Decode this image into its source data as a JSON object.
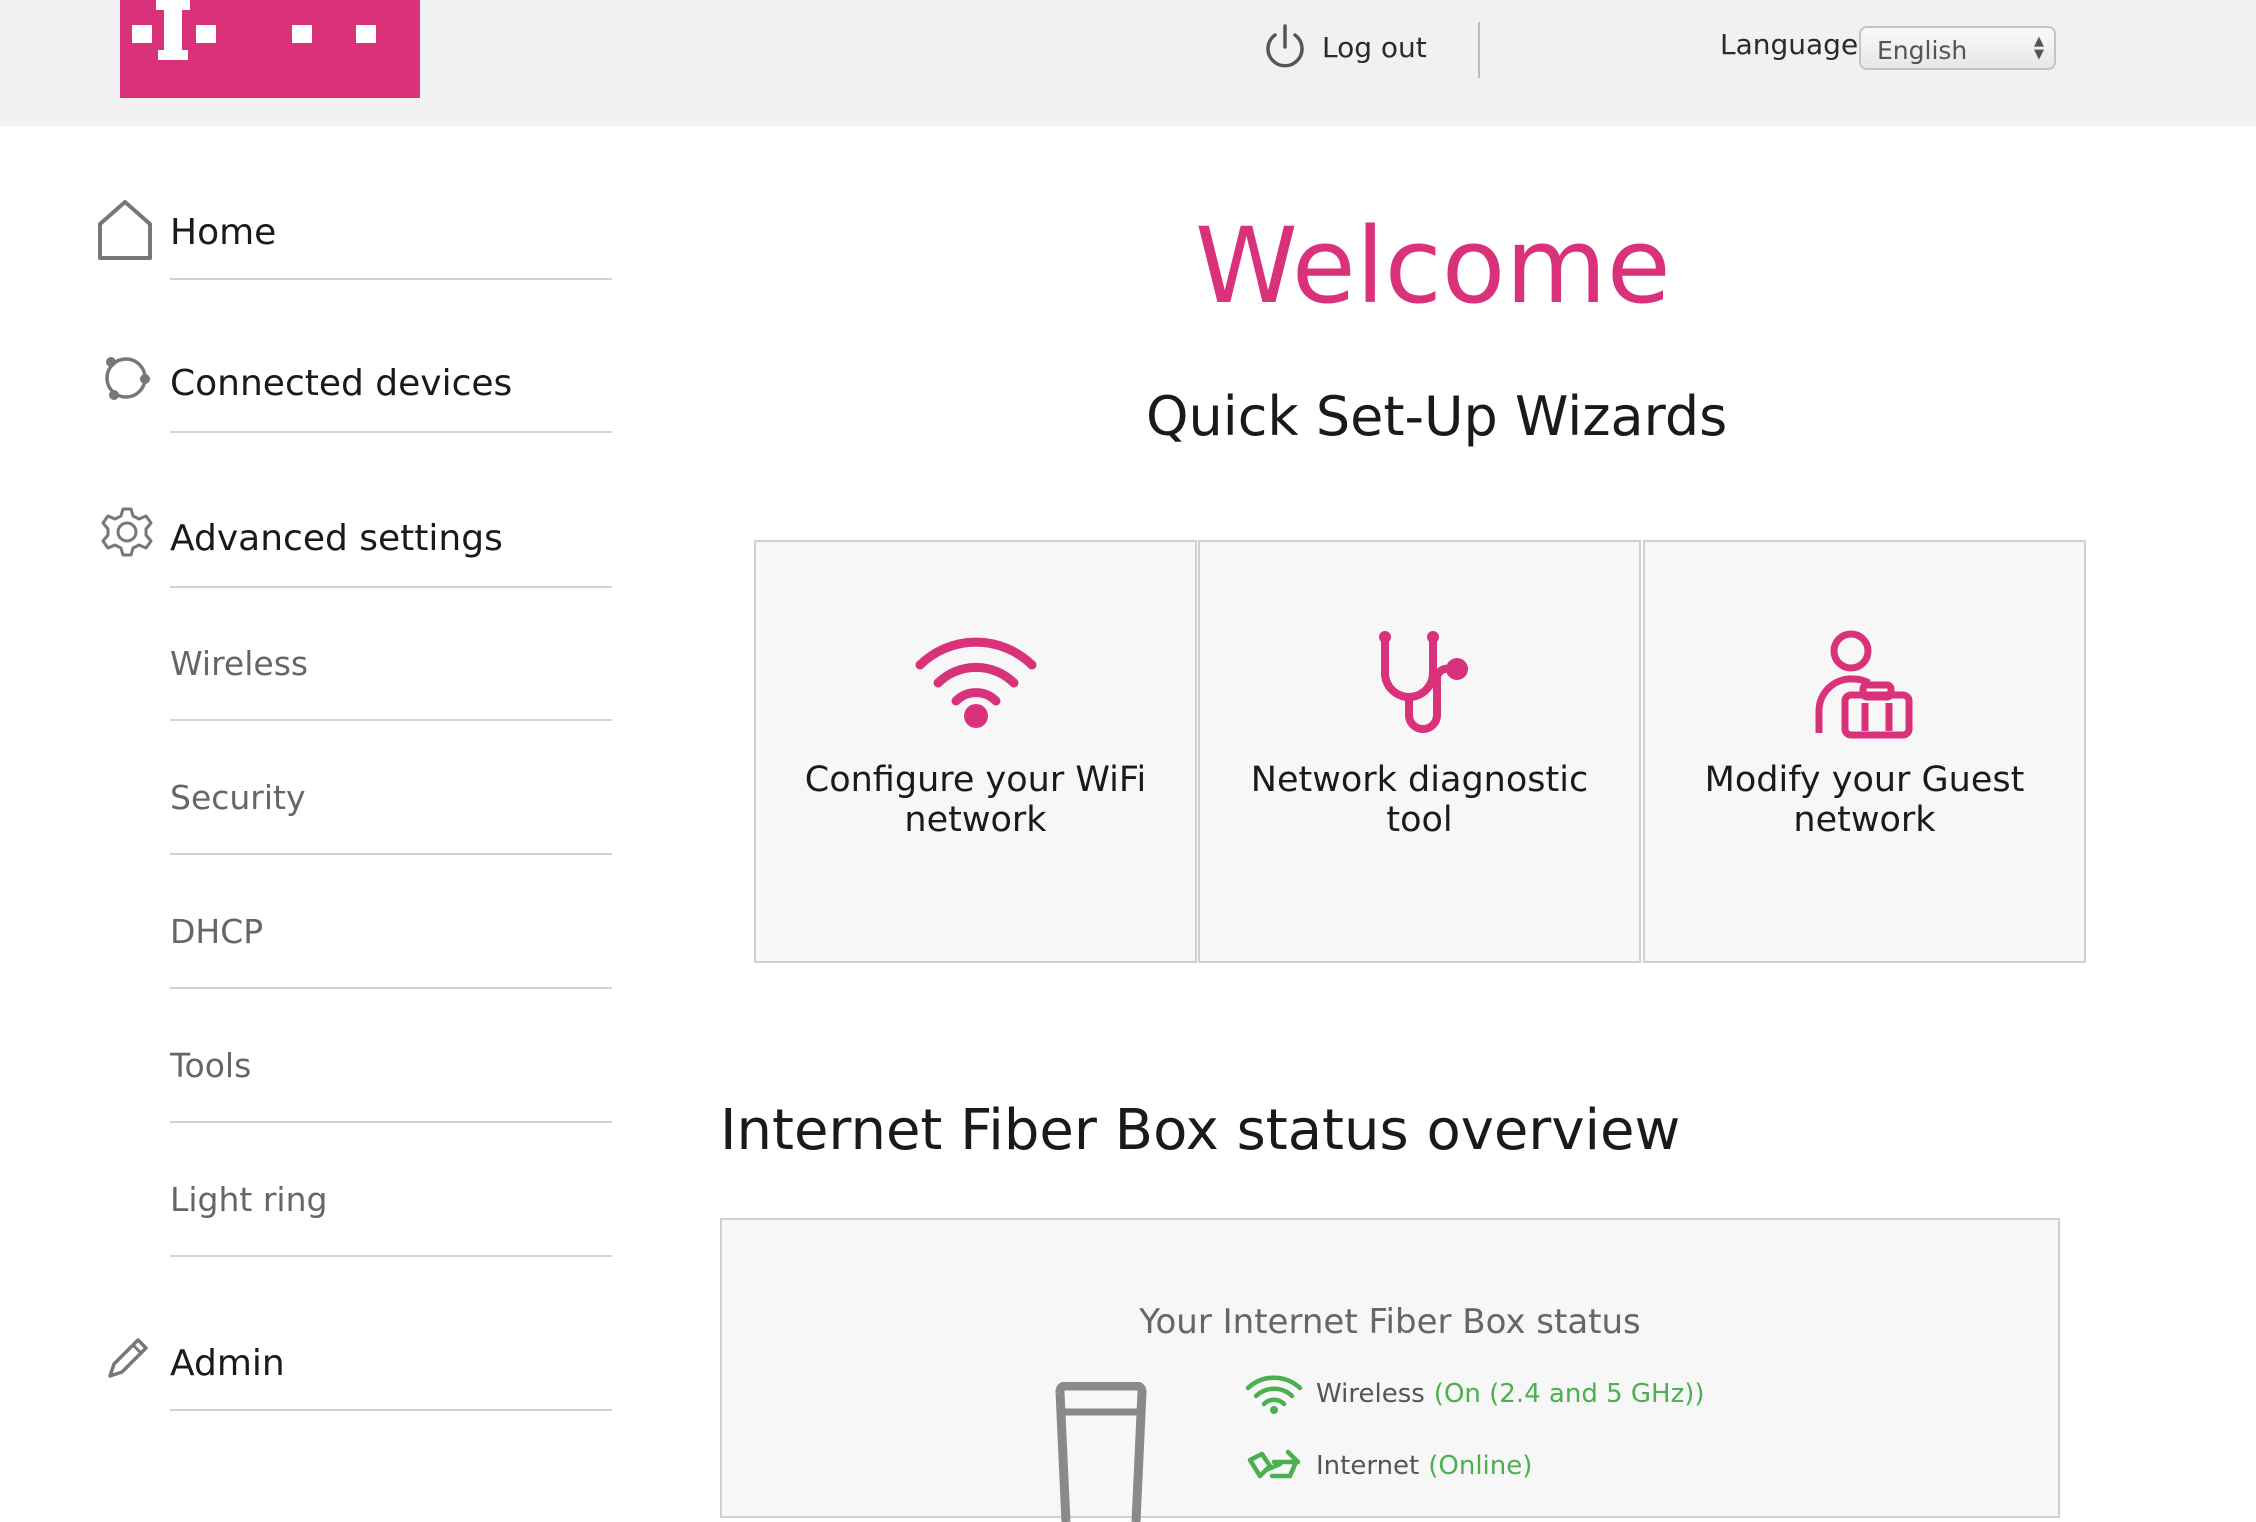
{
  "header": {
    "logout_label": "Log out",
    "language_label": "Language",
    "language_selected": "English"
  },
  "sidebar": {
    "items": [
      {
        "label": "Home",
        "icon": "home-icon"
      },
      {
        "label": "Connected devices",
        "icon": "connected-devices-icon"
      },
      {
        "label": "Advanced settings",
        "icon": "gear-icon"
      },
      {
        "label": "Admin",
        "icon": "pencil-icon"
      }
    ],
    "sub_items": [
      "Wireless",
      "Security",
      "DHCP",
      "Tools",
      "Light ring"
    ]
  },
  "main": {
    "welcome": "Welcome",
    "wizards_title": "Quick Set-Up Wizards",
    "wizards": [
      {
        "label": "Configure your WiFi network",
        "icon": "wifi-icon"
      },
      {
        "label": "Network diagnostic tool",
        "icon": "stethoscope-icon"
      },
      {
        "label": "Modify your Guest network",
        "icon": "guest-user-icon"
      }
    ],
    "status_title": "Internet Fiber Box status overview",
    "status_box": {
      "heading": "Your Internet Fiber Box status",
      "lines": [
        {
          "label": "Wireless",
          "value": "(On (2.4 and 5 GHz))",
          "icon": "wifi-icon"
        },
        {
          "label": "Internet",
          "value": "(Online)",
          "icon": "internet-link-icon"
        }
      ]
    }
  },
  "colors": {
    "brand_magenta": "#d9317a",
    "status_green": "#4caf50",
    "header_bg": "#f1f1f1",
    "card_bg": "#f7f7f7"
  }
}
